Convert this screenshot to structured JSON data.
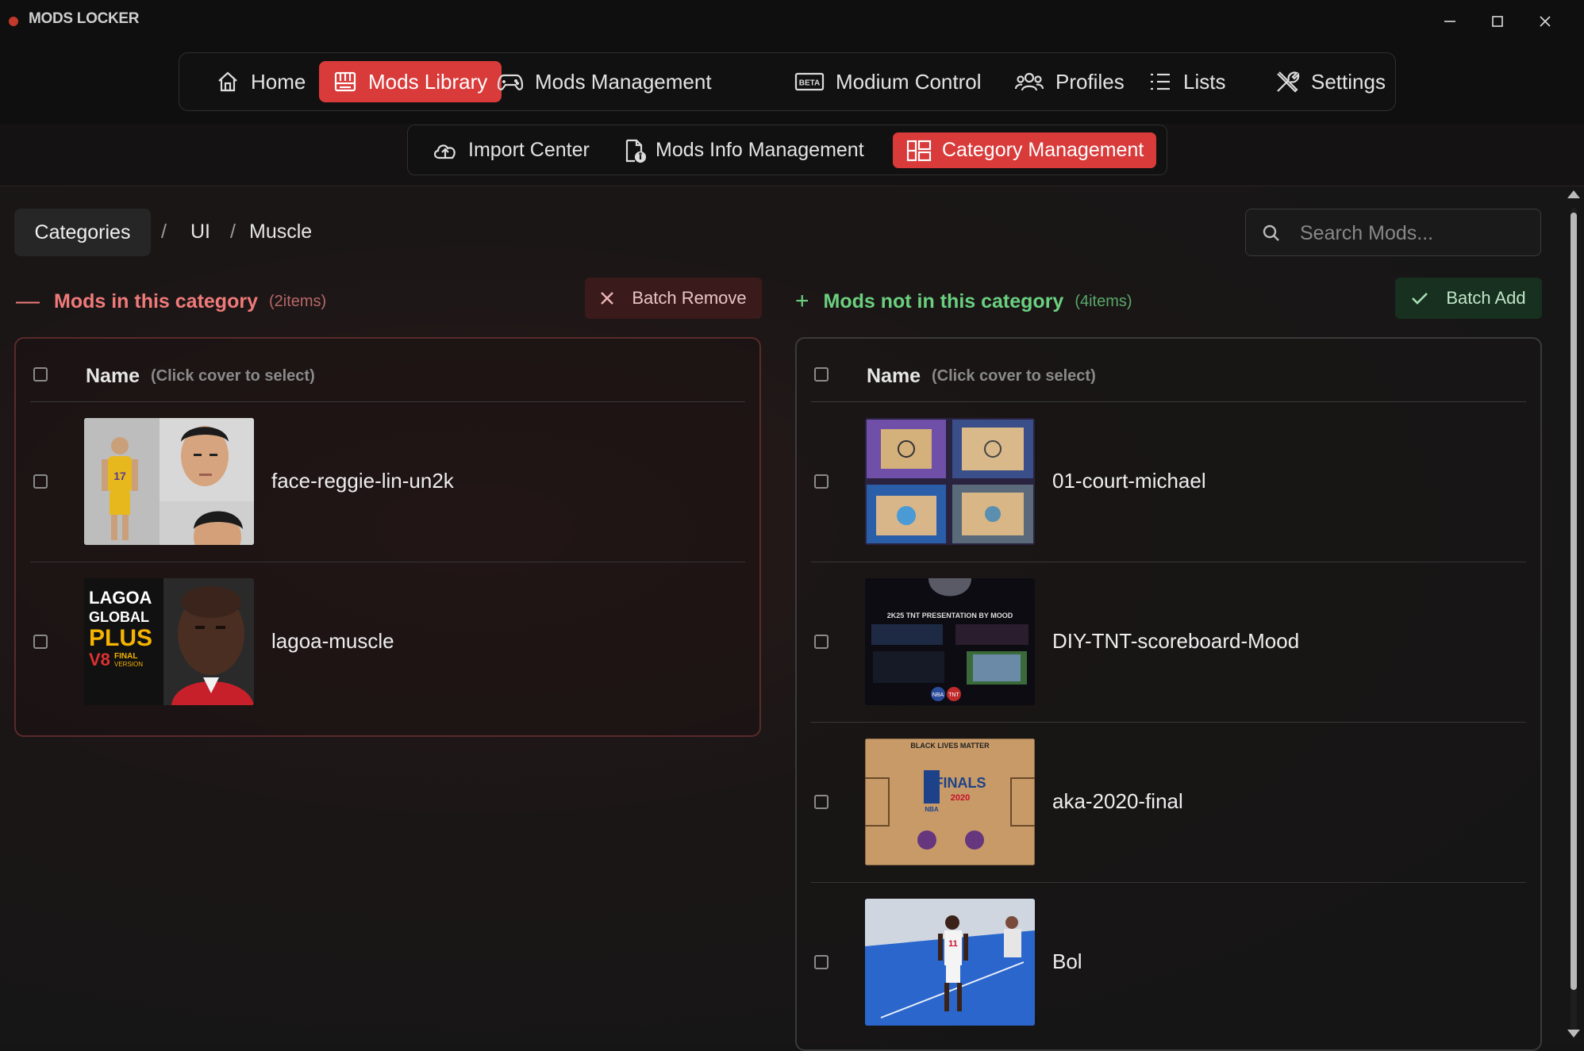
{
  "window": {
    "title": "MODS LOCKER",
    "accent": "#d93a3a"
  },
  "main_nav": [
    {
      "label": "Home",
      "icon": "home-icon",
      "active": false
    },
    {
      "label": "Mods Library",
      "icon": "library-icon",
      "active": true
    },
    {
      "label": "Mods Management",
      "icon": "gamepad-icon",
      "active": false
    },
    {
      "label": "Modium Control",
      "icon": "beta-icon",
      "active": false
    },
    {
      "label": "Profiles",
      "icon": "users-icon",
      "active": false
    },
    {
      "label": "Lists",
      "icon": "list-icon",
      "active": false
    },
    {
      "label": "Settings",
      "icon": "tools-icon",
      "active": false
    }
  ],
  "sub_nav": [
    {
      "label": "Import Center",
      "icon": "cloud-upload-icon",
      "active": false
    },
    {
      "label": "Mods Info Management",
      "icon": "file-info-icon",
      "active": false
    },
    {
      "label": "Category Management",
      "icon": "category-icon",
      "active": true
    }
  ],
  "breadcrumb": {
    "root": "Categories",
    "items": [
      "UI",
      "Muscle"
    ],
    "separator": "/"
  },
  "search": {
    "placeholder": "Search Mods...",
    "value": ""
  },
  "in_category": {
    "title": "Mods in this category",
    "symbol": "—",
    "count": "(2items)",
    "action": "Batch Remove",
    "header_name": "Name",
    "header_hint": "(Click cover to select)",
    "mods": [
      {
        "name": "face-reggie-lin-un2k",
        "checked": false
      },
      {
        "name": "lagoa-muscle",
        "checked": false
      }
    ]
  },
  "not_in_category": {
    "title": "Mods not in this category",
    "symbol": "+",
    "count": "(4items)",
    "action": "Batch Add",
    "header_name": "Name",
    "header_hint": "(Click cover to select)",
    "mods": [
      {
        "name": "01-court-michael",
        "checked": false
      },
      {
        "name": "DIY-TNT-scoreboard-Mood",
        "checked": false
      },
      {
        "name": "aka-2020-final",
        "checked": false
      },
      {
        "name": "Bol",
        "checked": false
      }
    ]
  },
  "thumb_text": {
    "lagoa_line1": "LAGOA",
    "lagoa_line2": "GLOBAL",
    "lagoa_line3": "PLUS",
    "lagoa_line4": "V8",
    "lagoa_line5": "FINAL",
    "lagoa_line6": "VERSION",
    "finals_top": "BLACK LIVES MATTER",
    "finals_nba": "NBA",
    "finals_word": "FINALS",
    "finals_year": "2020",
    "tnt_title": "2K25 TNT PRESENTATION BY MOOD",
    "tnt_nba": "NBA",
    "tnt_tnt": "TNT",
    "jersey_17": "17",
    "jersey_11": "11"
  }
}
